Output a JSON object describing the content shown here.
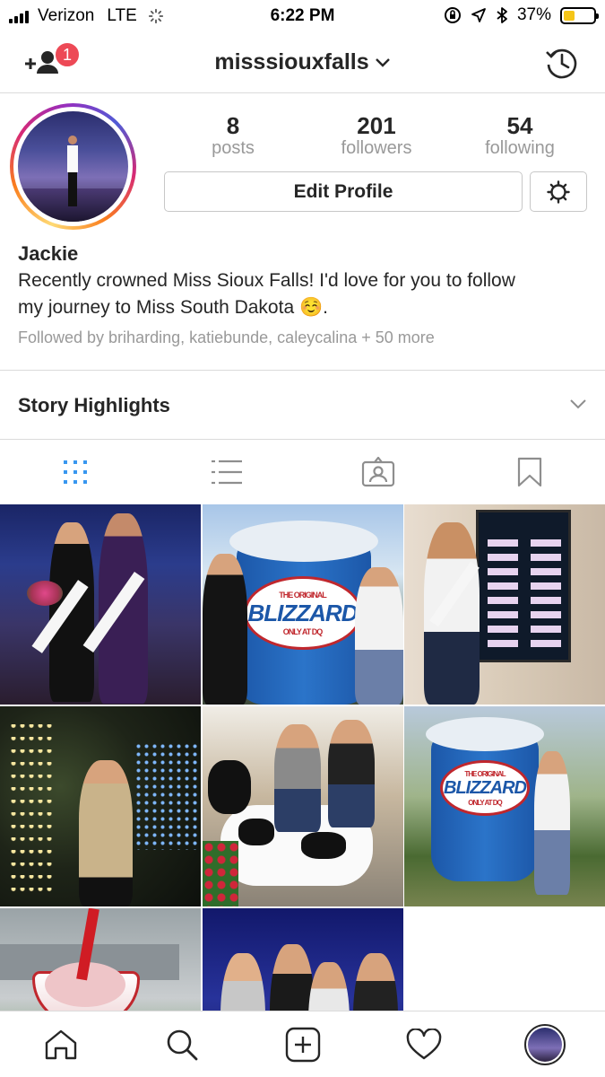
{
  "status_bar": {
    "carrier": "Verizon",
    "network": "LTE",
    "time": "6:22 PM",
    "battery": "37%",
    "battery_level": 0.37
  },
  "header": {
    "notification_count": "1",
    "username": "misssiouxfalls"
  },
  "profile": {
    "stats": [
      {
        "value": "8",
        "label": "posts"
      },
      {
        "value": "201",
        "label": "followers"
      },
      {
        "value": "54",
        "label": "following"
      }
    ],
    "edit_profile_label": "Edit Profile",
    "name": "Jackie",
    "bio_line1": "Recently crowned Miss Sioux Falls! I'd love for you to follow",
    "bio_line2": "my journey to Miss South Dakota ☺️.",
    "followed_by": "Followed by briharding, katiebunde, caleycalina + 50 more"
  },
  "story_highlights": {
    "label": "Story Highlights"
  },
  "tabs": [
    {
      "icon": "grid-icon",
      "active": true
    },
    {
      "icon": "list-icon",
      "active": false
    },
    {
      "icon": "tagged-icon",
      "active": false
    },
    {
      "icon": "bookmark-icon",
      "active": false
    }
  ],
  "posts": [
    {
      "scene": "two women in sashes on stage"
    },
    {
      "scene": "blizzard cup with two women"
    },
    {
      "scene": "woman beside display board"
    },
    {
      "scene": "woman at night with lights"
    },
    {
      "scene": "women on cow statue"
    },
    {
      "scene": "woman beside blizzard cup"
    },
    {
      "scene": "blizzard treat closeup"
    },
    {
      "scene": "crowned contestants on stage"
    }
  ],
  "photo_text": {
    "blizzard_top": "THE ORIGINAL",
    "blizzard_brand": "BLIZZARD",
    "blizzard_bottom": "ONLY AT DQ"
  },
  "colors": {
    "accent_blue": "#3897f0",
    "badge_red": "#ed4956",
    "muted": "#999999",
    "border": "#dbdbdb"
  }
}
